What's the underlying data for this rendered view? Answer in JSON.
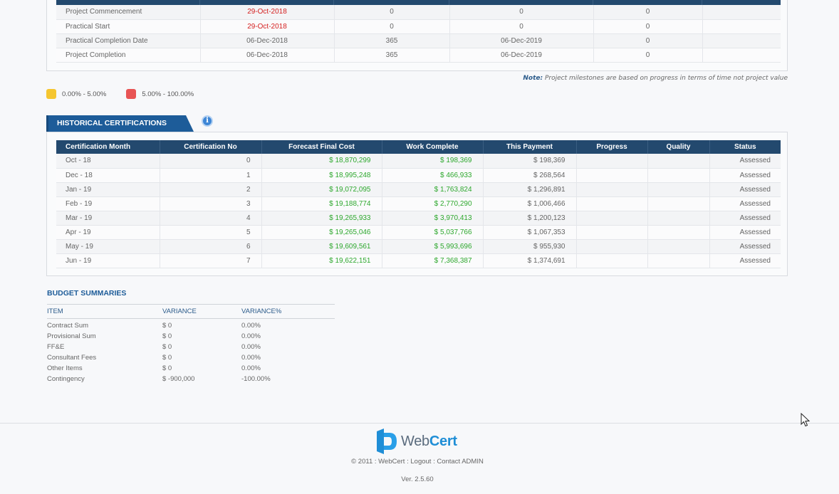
{
  "milestones": {
    "rows": [
      {
        "name": "Project Commencement",
        "date": "29-Oct-2018",
        "days": "0",
        "end": "0",
        "value": "0",
        "late": true
      },
      {
        "name": "Practical Start",
        "date": "29-Oct-2018",
        "days": "0",
        "end": "0",
        "value": "0",
        "late": true
      },
      {
        "name": "Practical Completion Date",
        "date": "06-Dec-2018",
        "days": "365",
        "end": "06-Dec-2019",
        "value": "0",
        "late": false
      },
      {
        "name": "Project Completion",
        "date": "06-Dec-2018",
        "days": "365",
        "end": "06-Dec-2019",
        "value": "0",
        "late": false
      }
    ],
    "note_label": "Note:",
    "note_text": " Project milestones are based on progress in terms of time not project value"
  },
  "legend": [
    {
      "label": "0.00% - 5.00%",
      "color": "#f5c630"
    },
    {
      "label": "5.00% - 100.00%",
      "color": "#e85454"
    }
  ],
  "historical": {
    "tab_label": "HISTORICAL CERTIFICATIONS",
    "info_icon": "i",
    "headers": [
      "Certification Month",
      "Certification No",
      "Forecast Final Cost",
      "Work Complete",
      "This Payment",
      "Progress",
      "Quality",
      "Status"
    ],
    "rows": [
      {
        "month": "Oct - 18",
        "no": "0",
        "forecast": "$ 18,870,299",
        "work": "$ 198,369",
        "payment": "$ 198,369",
        "progress": "",
        "quality": "",
        "status": "Assessed"
      },
      {
        "month": "Dec - 18",
        "no": "1",
        "forecast": "$ 18,995,248",
        "work": "$ 466,933",
        "payment": "$ 268,564",
        "progress": "",
        "quality": "",
        "status": "Assessed"
      },
      {
        "month": "Jan - 19",
        "no": "2",
        "forecast": "$ 19,072,095",
        "work": "$ 1,763,824",
        "payment": "$ 1,296,891",
        "progress": "",
        "quality": "",
        "status": "Assessed"
      },
      {
        "month": "Feb - 19",
        "no": "3",
        "forecast": "$ 19,188,774",
        "work": "$ 2,770,290",
        "payment": "$ 1,006,466",
        "progress": "",
        "quality": "",
        "status": "Assessed"
      },
      {
        "month": "Mar - 19",
        "no": "4",
        "forecast": "$ 19,265,933",
        "work": "$ 3,970,413",
        "payment": "$ 1,200,123",
        "progress": "",
        "quality": "",
        "status": "Assessed"
      },
      {
        "month": "Apr - 19",
        "no": "5",
        "forecast": "$ 19,265,046",
        "work": "$ 5,037,766",
        "payment": "$ 1,067,353",
        "progress": "",
        "quality": "",
        "status": "Assessed"
      },
      {
        "month": "May - 19",
        "no": "6",
        "forecast": "$ 19,609,561",
        "work": "$ 5,993,696",
        "payment": "$ 955,930",
        "progress": "",
        "quality": "",
        "status": "Assessed"
      },
      {
        "month": "Jun - 19",
        "no": "7",
        "forecast": "$ 19,622,151",
        "work": "$ 7,368,387",
        "payment": "$ 1,374,691",
        "progress": "",
        "quality": "",
        "status": "Assessed"
      }
    ]
  },
  "budget": {
    "title": "BUDGET SUMMARIES",
    "headers": [
      "ITEM",
      "VARIANCE",
      "VARIANCE%"
    ],
    "rows": [
      {
        "item": "Contract Sum",
        "variance": "$ 0",
        "pct": "0.00%"
      },
      {
        "item": "Provisional Sum",
        "variance": "$ 0",
        "pct": "0.00%"
      },
      {
        "item": "FF&E",
        "variance": "$ 0",
        "pct": "0.00%"
      },
      {
        "item": "Consultant Fees",
        "variance": "$ 0",
        "pct": "0.00%"
      },
      {
        "item": "Other Items",
        "variance": "$ 0",
        "pct": "0.00%"
      },
      {
        "item": "Contingency",
        "variance": "$ -900,000",
        "pct": "-100.00%"
      }
    ]
  },
  "footer": {
    "logo_text_a": "Web",
    "logo_text_b": "Cert",
    "copyright_prefix": "© 2011 : WebCert : ",
    "logout": "Logout",
    "sep": " : ",
    "contact": "Contact ADMIN",
    "version": "Ver. 2.5.60"
  },
  "colors": {
    "header_bg": "#23496e",
    "tab_bg": "#1d5c99",
    "money_green": "#2ea82e",
    "late_red": "#d42020"
  }
}
